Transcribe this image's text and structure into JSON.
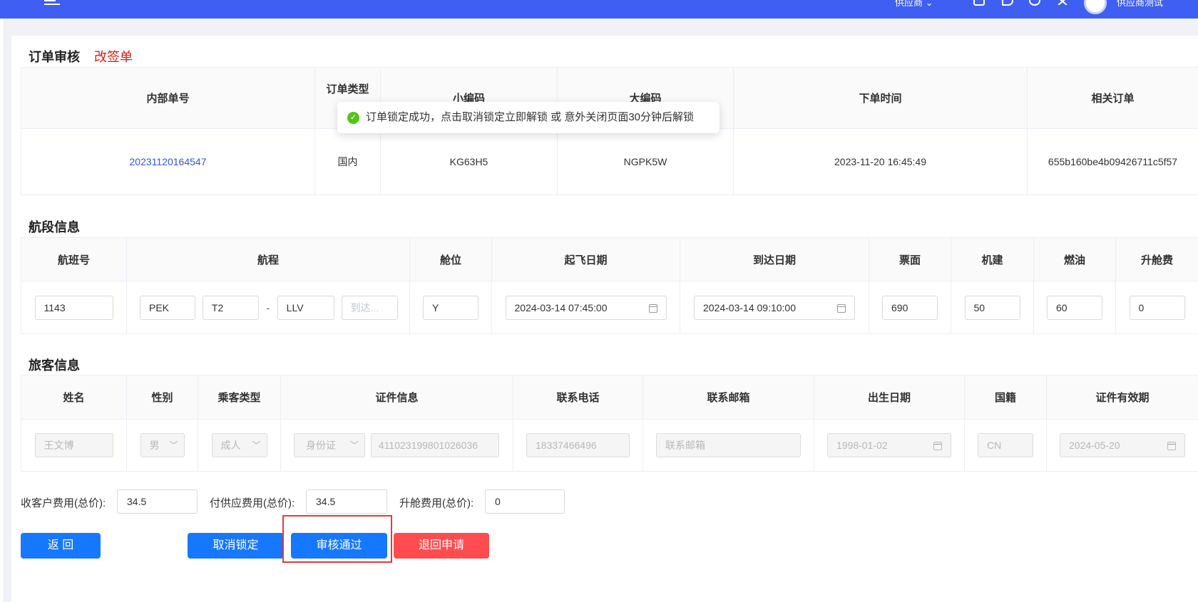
{
  "topbar": {
    "user_menu": "供应商",
    "user_name": "供应商测试"
  },
  "order": {
    "title": "订单审核",
    "tag": "改签单",
    "headers": [
      "内部单号",
      "订单类型",
      "小编码",
      "大编码",
      "下单时间",
      "相关订单"
    ],
    "row": {
      "internal_no": "20231120164547",
      "order_type": "国内",
      "small_code": "KG63H5",
      "big_code": "NGPK5W",
      "order_time": "2023-11-20 16:45:49",
      "related_order": "655b160be4b09426711c5f57"
    }
  },
  "toast": {
    "message": "订单锁定成功，点击取消锁定立即解锁 或 意外关闭页面30分钟后解锁"
  },
  "segment": {
    "title": "航段信息",
    "headers": [
      "航班号",
      "航程",
      "舱位",
      "起飞日期",
      "到达日期",
      "票面",
      "机建",
      "燃油",
      "升舱费"
    ],
    "row": {
      "flight_no": "1143",
      "from": "PEK",
      "from_terminal": "T2",
      "dash": "-",
      "to": "LLV",
      "to_terminal_placeholder": "到达...",
      "cabin": "Y",
      "depart": "2024-03-14 07:45:00",
      "arrive": "2024-03-14 09:10:00",
      "fare": "690",
      "airport_tax": "50",
      "fuel": "60",
      "upgrade_fee": "0"
    }
  },
  "passenger": {
    "title": "旅客信息",
    "headers": [
      "姓名",
      "性别",
      "乘客类型",
      "证件信息",
      "联系电话",
      "联系邮箱",
      "出生日期",
      "国籍",
      "证件有效期"
    ],
    "row": {
      "name": "王文博",
      "gender": "男",
      "type": "成人",
      "id_type": "身份证",
      "id_no": "411023199801026036",
      "phone": "18337466496",
      "email_placeholder": "联系邮箱",
      "birth": "1998-01-02",
      "nationality": "CN",
      "id_expiry": "2024-05-20"
    }
  },
  "fees": {
    "customer_label": "收客户费用(总价):",
    "customer_value": "34.5",
    "supplier_label": "付供应费用(总价):",
    "supplier_value": "34.5",
    "upgrade_label": "升舱费用(总价):",
    "upgrade_value": "0"
  },
  "buttons": {
    "back": "返 回",
    "unlock": "取消锁定",
    "approve": "审核通过",
    "reject": "退回申请"
  },
  "colors": {
    "topbar": "#3f5ff3",
    "primary": "#1677ff",
    "danger": "#ff4d4f",
    "tag": "#e8180c",
    "success": "#52c41a"
  }
}
